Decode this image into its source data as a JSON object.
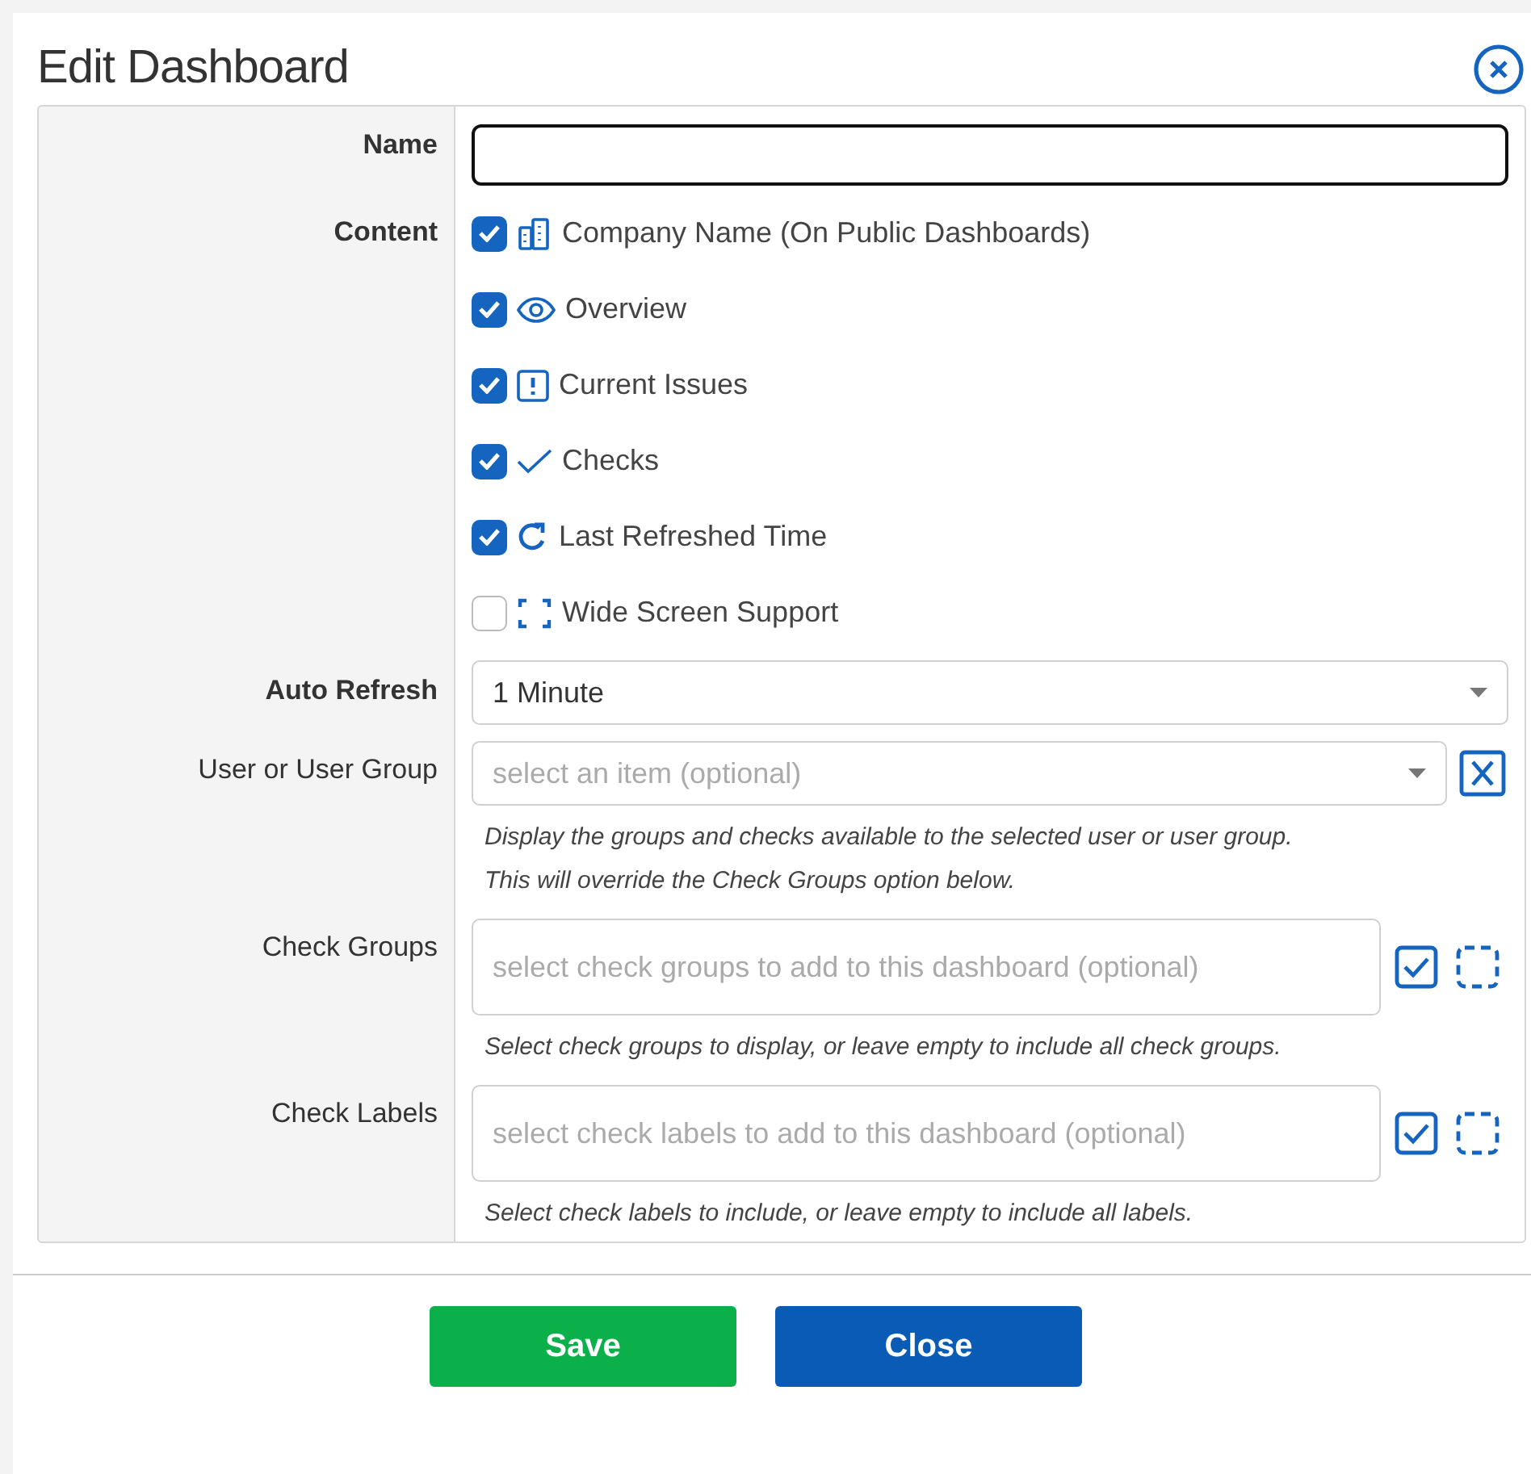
{
  "dialog": {
    "title": "Edit Dashboard"
  },
  "fields": [
    {
      "kind": "text",
      "label": "Name",
      "bold": true
    },
    {
      "kind": "checklist",
      "label": "Content",
      "bold": true,
      "items": [
        {
          "label": "Company Name (On Public Dashboards)",
          "checked": true
        },
        {
          "label": "Overview",
          "checked": true
        },
        {
          "label": "Current Issues",
          "checked": true
        },
        {
          "label": "Checks",
          "checked": true
        },
        {
          "label": "Last Refreshed Time",
          "checked": true
        },
        {
          "label": "Wide Screen Support",
          "checked": false
        }
      ]
    },
    {
      "kind": "select",
      "label": "Auto Refresh",
      "bold": true,
      "value": "1 Minute"
    },
    {
      "kind": "select-clear",
      "label": "User or User Group",
      "bold": false,
      "placeholder": "select an item (optional)",
      "help": [
        "Display the groups and checks available to the selected user or user group.",
        "This will override the Check Groups option below."
      ]
    },
    {
      "kind": "multi",
      "label": "Check Groups",
      "bold": false,
      "placeholder": "select check groups to add to this dashboard (optional)",
      "help": [
        "Select check groups to display, or leave empty to include all check groups."
      ]
    },
    {
      "kind": "multi",
      "label": "Check Labels",
      "bold": false,
      "placeholder": "select check labels to add to this dashboard (optional)",
      "help": [
        "Select check labels to include, or leave empty to include all labels."
      ]
    }
  ],
  "buttons": [
    {
      "label": "Save",
      "kind": "primary"
    },
    {
      "label": "Close",
      "kind": "secondary"
    }
  ]
}
